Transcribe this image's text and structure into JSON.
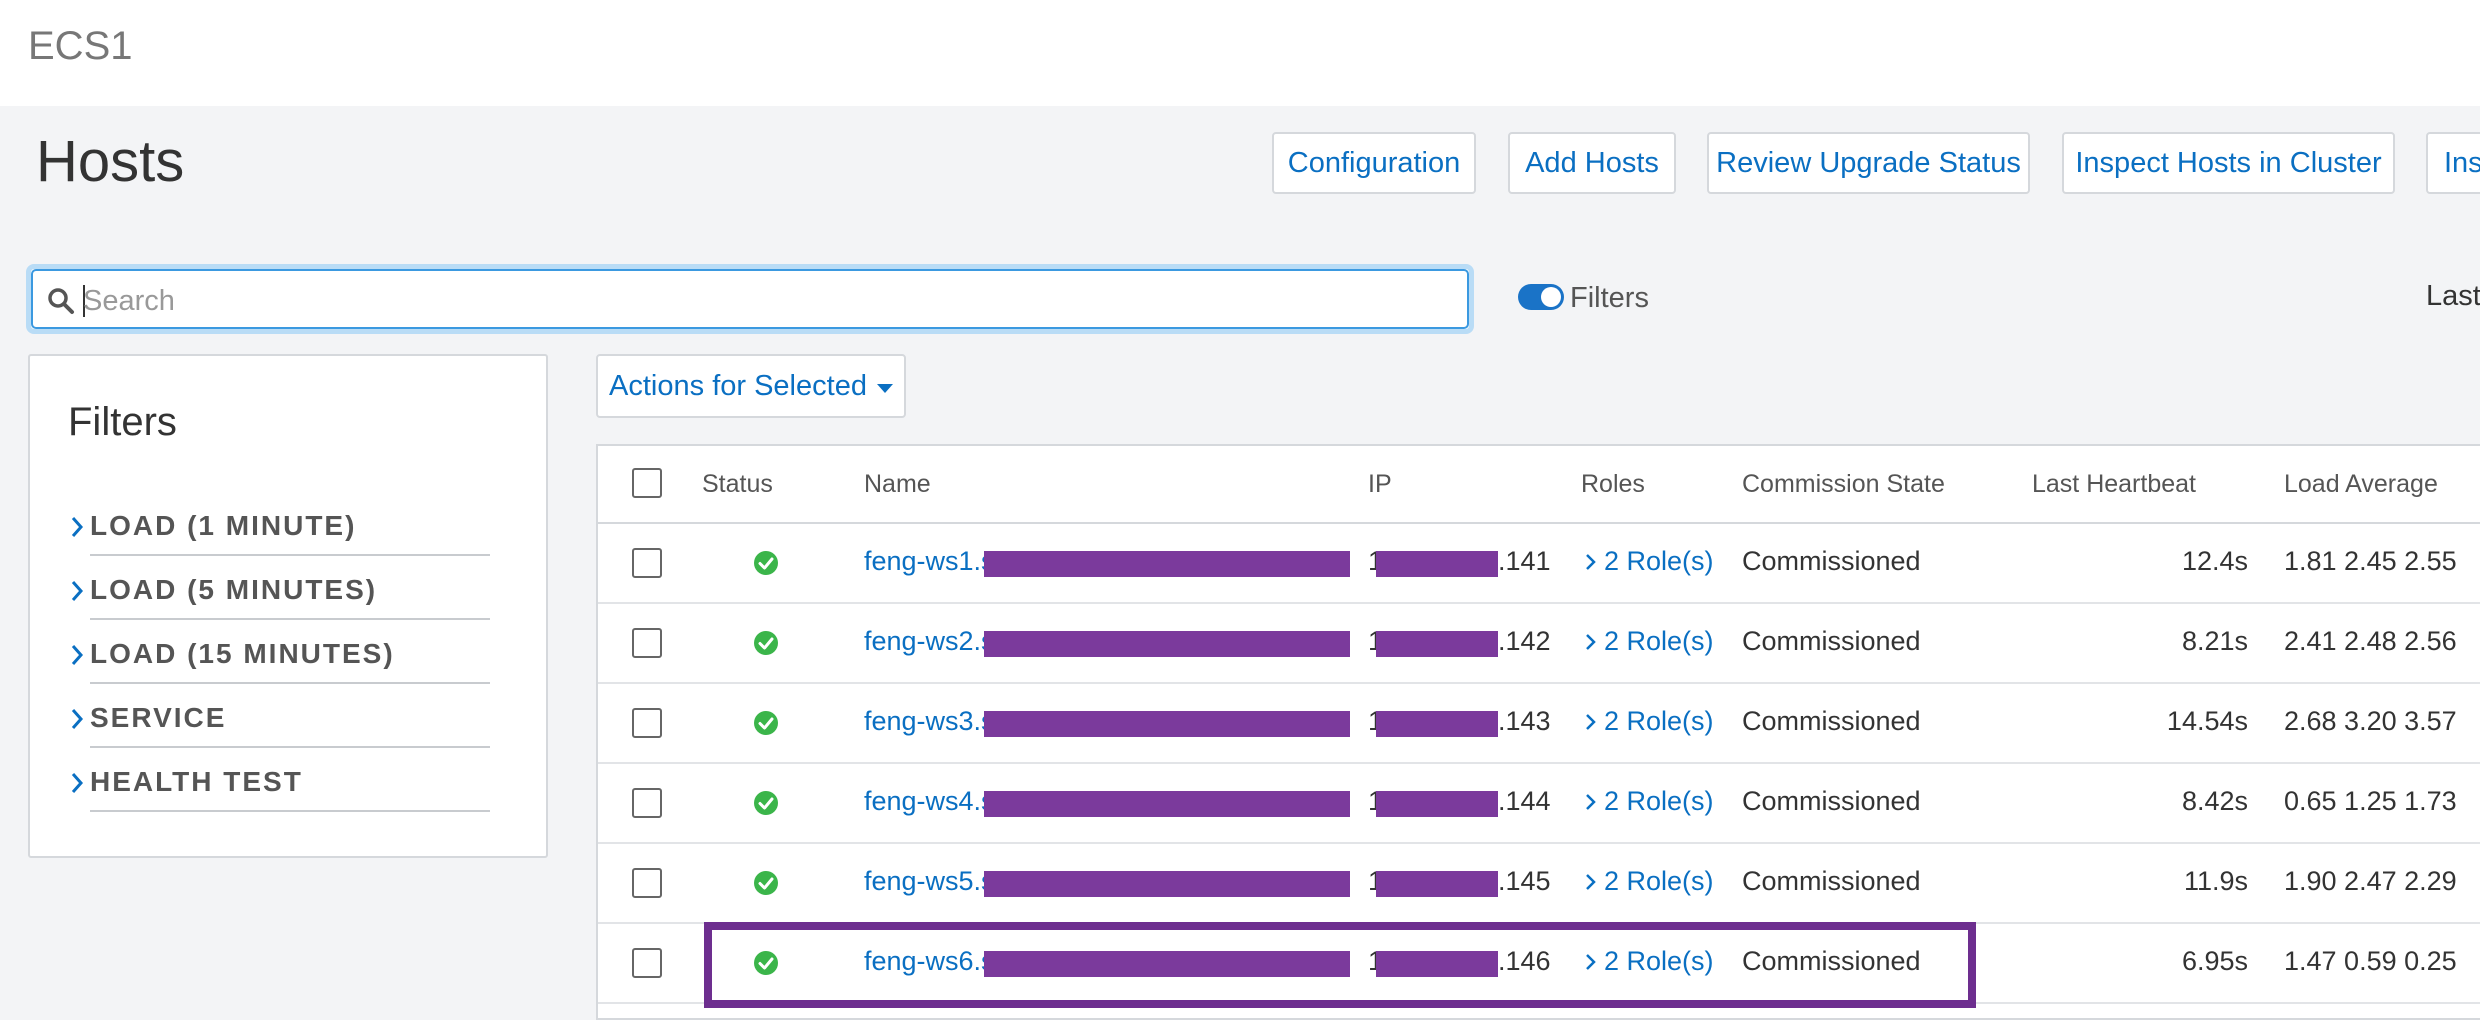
{
  "cluster": {
    "name": "ECS1"
  },
  "page": {
    "title": "Hosts"
  },
  "toolbar": {
    "buttons": [
      "Configuration",
      "Add Hosts",
      "Review Upgrade Status",
      "Inspect Hosts in Cluster",
      "Ins"
    ]
  },
  "search": {
    "placeholder": "Search",
    "value": ""
  },
  "filters_toggle": {
    "label": "Filters",
    "on": true
  },
  "time_label": "Last",
  "filter_panel": {
    "title": "Filters",
    "items": [
      "LOAD (1 MINUTE)",
      "LOAD (5 MINUTES)",
      "LOAD (15 MINUTES)",
      "SERVICE",
      "HEALTH TEST"
    ]
  },
  "actions": {
    "label": "Actions for Selected"
  },
  "table": {
    "columns": [
      "Status",
      "Name",
      "IP",
      "Roles",
      "Commission State",
      "Last Heartbeat",
      "Load Average"
    ],
    "rows": [
      {
        "status": "good",
        "name": "feng-ws1.s",
        "ip_prefix": "1",
        "ip_suffix": ".141",
        "roles": "2 Role(s)",
        "commission": "Commissioned",
        "heartbeat": "12.4s",
        "load": "1.81 2.45 2.55"
      },
      {
        "status": "good",
        "name": "feng-ws2.s",
        "ip_prefix": "1",
        "ip_suffix": ".142",
        "roles": "2 Role(s)",
        "commission": "Commissioned",
        "heartbeat": "8.21s",
        "load": "2.41 2.48 2.56"
      },
      {
        "status": "good",
        "name": "feng-ws3.s",
        "ip_prefix": "1",
        "ip_suffix": ".143",
        "roles": "2 Role(s)",
        "commission": "Commissioned",
        "heartbeat": "14.54s",
        "load": "2.68 3.20 3.57"
      },
      {
        "status": "good",
        "name": "feng-ws4.s",
        "ip_prefix": "1",
        "ip_suffix": ".144",
        "roles": "2 Role(s)",
        "commission": "Commissioned",
        "heartbeat": "8.42s",
        "load": "0.65 1.25 1.73"
      },
      {
        "status": "good",
        "name": "feng-ws5.s",
        "ip_prefix": "1",
        "ip_suffix": ".145",
        "roles": "2 Role(s)",
        "commission": "Commissioned",
        "heartbeat": "11.9s",
        "load": "1.90 2.47 2.29"
      },
      {
        "status": "good",
        "name": "feng-ws6.s",
        "ip_prefix": "1",
        "ip_suffix": ".146",
        "roles": "2 Role(s)",
        "commission": "Commissioned",
        "heartbeat": "6.95s",
        "load": "1.47 0.59 0.25"
      }
    ]
  },
  "colors": {
    "link": "#0a6fc2",
    "status_good": "#3bb54a",
    "redaction": "#7b3a9c",
    "highlight": "#6d2e8f"
  }
}
